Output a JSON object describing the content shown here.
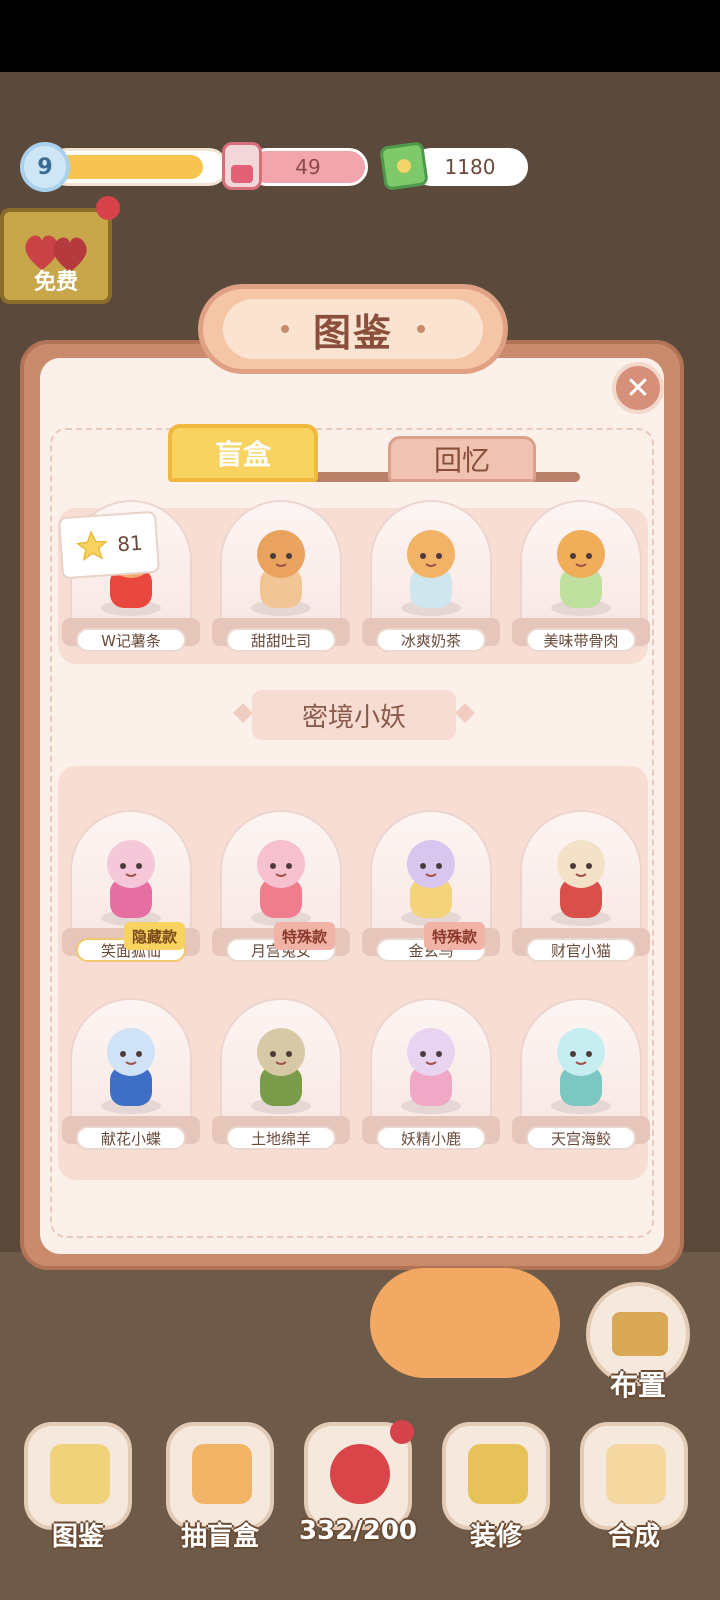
{
  "hud": {
    "level": "9",
    "level_progress": 0.9,
    "hearts": "49",
    "cash": "1180"
  },
  "free_button": {
    "label": "免费"
  },
  "panel": {
    "title": "图鉴",
    "close_icon": "close-icon",
    "tabs": [
      {
        "label": "盲盒",
        "active": true
      },
      {
        "label": "回忆",
        "active": false
      }
    ],
    "star_count": "81",
    "top_row": [
      {
        "name": "W记薯条"
      },
      {
        "name": "甜甜吐司"
      },
      {
        "name": "冰爽奶茶"
      },
      {
        "name": "美味带骨肉"
      }
    ],
    "section_title": "密境小妖",
    "grid": [
      {
        "name": "笑面狐仙",
        "badge": "隐藏款",
        "badge_type": "hidden"
      },
      {
        "name": "月宫兔女",
        "badge": "特殊款",
        "badge_type": "special"
      },
      {
        "name": "金玄鸟",
        "badge": "特殊款",
        "badge_type": "special"
      },
      {
        "name": "财官小猫",
        "badge": ""
      },
      {
        "name": "献花小蝶",
        "badge": ""
      },
      {
        "name": "土地绵羊",
        "badge": ""
      },
      {
        "name": "妖精小鹿",
        "badge": ""
      },
      {
        "name": "天宫海鲛",
        "badge": ""
      }
    ]
  },
  "bottom_bar": {
    "arrange": "布置",
    "items": [
      {
        "label": "图鉴",
        "icon": "book-icon"
      },
      {
        "label": "抽盲盒",
        "icon": "vending-machine-icon"
      },
      {
        "label": "332/200",
        "icon": "heart-icon"
      },
      {
        "label": "装修",
        "icon": "paint-roller-icon"
      },
      {
        "label": "合成",
        "icon": "clipboard-icon"
      }
    ]
  },
  "colors": {
    "panel_frame": "#c98b6b",
    "panel_bg": "#fbf0ea",
    "tab_active": "#f8d35f",
    "badge_hidden": "#f8d35f",
    "badge_special": "#f1b3a6"
  }
}
